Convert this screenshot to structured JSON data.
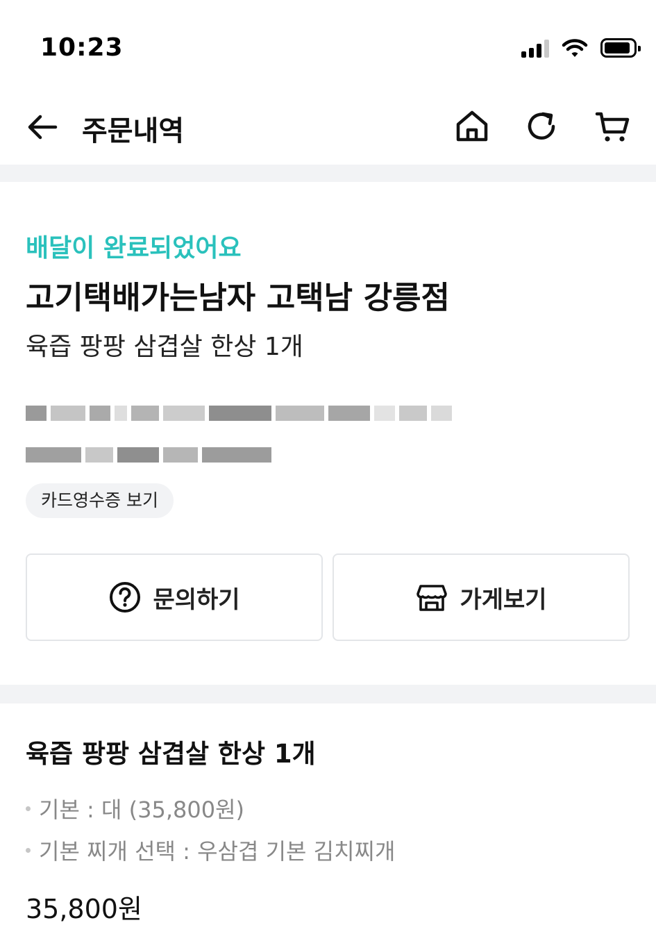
{
  "status_bar": {
    "time": "10:23"
  },
  "header": {
    "title": "주문내역",
    "icons": [
      "back-arrow-icon",
      "home-icon",
      "refresh-icon",
      "cart-icon"
    ]
  },
  "order_summary": {
    "status_message": "배달이 완료되었어요",
    "store_name": "고기택배가는남자 고택남 강릉점",
    "order_brief": "육즙 팡팡 삼겹살 한상 1개",
    "receipt_button": "카드영수증 보기",
    "inquiry_button": "문의하기",
    "store_button": "가게보기"
  },
  "order_detail": {
    "menu_title": "육즙 팡팡 삼겹살 한상 1개",
    "options": [
      "기본 : 대 (35,800원)",
      "기본 찌개 선택 : 우삼겹 기본 김치찌개"
    ],
    "price": "35,800원"
  },
  "colors": {
    "accent": "#2ac1bc",
    "divider": "#f2f3f5",
    "text_primary": "#111111",
    "text_secondary": "#888888"
  }
}
